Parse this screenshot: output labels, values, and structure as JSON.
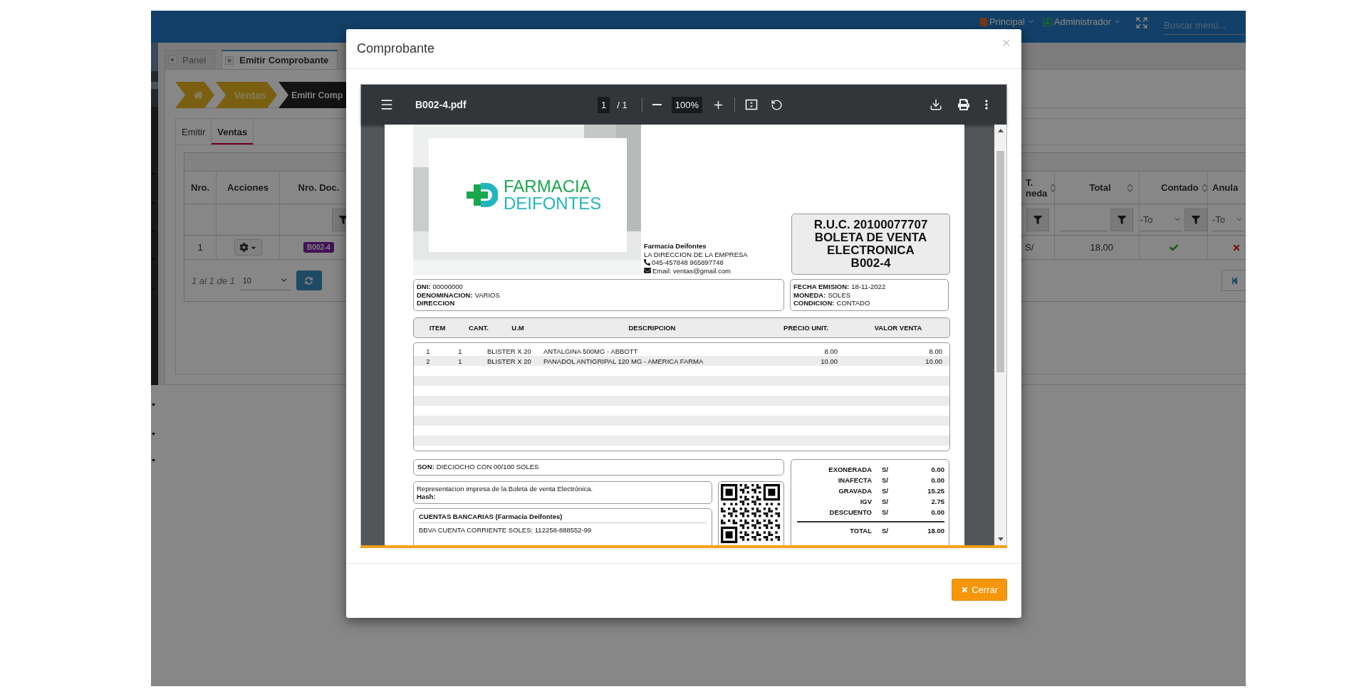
{
  "topbar": {
    "menus": [
      {
        "kind": "square",
        "label": "Principal"
      },
      {
        "kind": "user",
        "label": "Administrador"
      }
    ],
    "search": {
      "placeholder": "Buscar menú..."
    }
  },
  "tabs": [
    {
      "label": "Panel",
      "selected": false
    },
    {
      "label": "Emitir Comprobante",
      "selected": true
    }
  ],
  "breadcrumb": [
    {
      "label": "Ventas",
      "current": false
    },
    {
      "label": "Emitir Comp",
      "current": true
    }
  ],
  "subtabs": [
    {
      "label": "Emitir",
      "selected": false
    },
    {
      "label": "Ventas",
      "selected": true
    }
  ],
  "table": {
    "columns": [
      "Nro.",
      "Acciones",
      "Nro. Doc.",
      "T. neda",
      "Total",
      "Contado",
      "Anula"
    ],
    "filters": {
      "contado": "-To",
      "anula": "-To"
    },
    "rows": [
      {
        "nro": "1",
        "doc": "B002-4",
        "currency": "S/",
        "total": "18.00",
        "contado": true,
        "anulado": false
      }
    ],
    "pager": {
      "summary": "1 al 1 de 1",
      "page_size": "10"
    }
  },
  "modal": {
    "title": "Comprobante",
    "close": "×",
    "button": "Cerrar"
  },
  "pdf": {
    "filename": "B002-4.pdf",
    "page": "1",
    "page_total": "/ 1",
    "zoom": "100%"
  },
  "invoice": {
    "logo": {
      "line1": "FARMACIA",
      "line2": "DEIFONTES"
    },
    "company": {
      "name": "Farmacia Deifontes",
      "address": "LA DIRECCION DE LA EMPRESA",
      "phone": "045-457848 965897748",
      "email": "Email: ventas@gmail.com"
    },
    "document": [
      "R.U.C. 20100077707",
      "BOLETA DE VENTA",
      "ELECTRONICA",
      "B002-4"
    ],
    "client": [
      {
        "label": "DNI:",
        "value": "00000000"
      },
      {
        "label": "DENOMINACION:",
        "value": "VARIOS"
      },
      {
        "label": "DIRECCION"
      }
    ],
    "emission": [
      {
        "label": "FECHA EMISION:",
        "value": "18-11-2022"
      },
      {
        "label": "MONEDA:",
        "value": "SOLES"
      },
      {
        "label": "CONDICION:",
        "value": "CONTADO"
      }
    ],
    "item_columns": [
      "ITEM",
      "CANT.",
      "U.M",
      "DESCRIPCION",
      "PRECIO UNIT.",
      "VALOR VENTA"
    ],
    "items": [
      [
        "1",
        "1",
        "BLISTER X 20",
        "ANTALGINA 500MG - ABBOTT",
        "8.00",
        "8.00"
      ],
      [
        "2",
        "1",
        "BLISTER X 20",
        "PANADOL ANTIGRIPAL 120 MG - AMERICA FARMA",
        "10.00",
        "10.00"
      ]
    ],
    "amount_in_words": {
      "label": "SON:",
      "value": "DIECIOCHO CON 00/100 SOLES"
    },
    "notes": [
      {
        "text": "Representacion impresa de la Boleta de venta Electrónica.",
        "bold": false
      },
      {
        "text": "Hash:",
        "bold": true
      }
    ],
    "bank": {
      "title": "CUENTAS BANCARIAS (Farmacia Deifontes)",
      "accounts": [
        "BBVA CUENTA CORRIENTE SOLES: 112258-888552-99"
      ]
    },
    "totals": [
      {
        "label": "EXONERADA",
        "currency": "S/",
        "value": "0.00"
      },
      {
        "label": "INAFECTA",
        "currency": "S/",
        "value": "0.00"
      },
      {
        "label": "GRAVADA",
        "currency": "S/",
        "value": "15.25"
      },
      {
        "label": "IGV",
        "currency": "S/",
        "value": "2.75"
      },
      {
        "label": "DESCUENTO",
        "currency": "S/",
        "value": "0.00"
      }
    ],
    "grand_total": {
      "label": "TOTAL",
      "currency": "S/",
      "value": "18.00"
    }
  }
}
